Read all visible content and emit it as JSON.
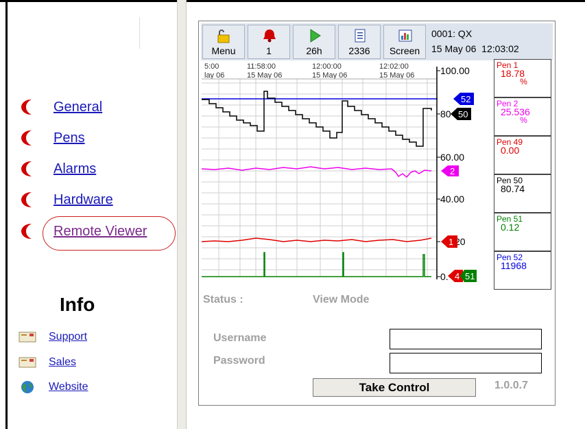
{
  "nav": {
    "items": [
      {
        "label": "General"
      },
      {
        "label": "Pens"
      },
      {
        "label": "Alarms"
      },
      {
        "label": "Hardware"
      },
      {
        "label": "Remote Viewer"
      }
    ]
  },
  "info": {
    "title": "Info",
    "links": [
      {
        "label": "Support",
        "icon": "envelope-icon"
      },
      {
        "label": "Sales",
        "icon": "envelope-icon"
      },
      {
        "label": "Website",
        "icon": "globe-icon"
      }
    ]
  },
  "toolbar": {
    "buttons": [
      {
        "label": "Menu",
        "icon": "padlock-icon"
      },
      {
        "label": "1",
        "icon": "alarm-bell-icon"
      },
      {
        "label": "26h",
        "icon": "play-icon"
      },
      {
        "label": "2336",
        "icon": "list-icon"
      },
      {
        "label": "Screen",
        "icon": "screen-chart-icon"
      }
    ],
    "device": "0001: QX",
    "date": "15 May 06",
    "time": "12:03:02"
  },
  "chart": {
    "time_ticks": [
      {
        "time": "5:00",
        "date": "lay 06"
      },
      {
        "time": "11:58:00",
        "date": "15 May 06"
      },
      {
        "time": "12:00:00",
        "date": "15 May 06"
      },
      {
        "time": "12:02:00",
        "date": "15 May 06"
      }
    ],
    "scale_labels": [
      "100.00",
      "80",
      "60.00",
      "40.00",
      "20",
      "0."
    ],
    "markers": [
      "52",
      "50",
      "2",
      "1",
      "4",
      "51"
    ],
    "colors": {
      "pen1": "#e00000",
      "pen2": "#ee00ee",
      "pen49": "#e00000",
      "pen50": "#000000",
      "pen51": "#008000",
      "pen52": "#0000e0"
    }
  },
  "pens": [
    {
      "name": "Pen 1",
      "value": "18.78",
      "unit": "%",
      "color": "#e00000"
    },
    {
      "name": "Pen 2",
      "value": "25.536",
      "unit": "%",
      "color": "#ee00ee"
    },
    {
      "name": "Pen 49",
      "value": "0.00",
      "unit": "",
      "color": "#e00000"
    },
    {
      "name": "Pen 50",
      "value": "80.74",
      "unit": "",
      "color": "#000000"
    },
    {
      "name": "Pen 51",
      "value": "0.12",
      "unit": "",
      "color": "#008000"
    },
    {
      "name": "Pen 52",
      "value": "11968",
      "unit": "",
      "color": "#0000e0"
    }
  ],
  "status": {
    "label": "Status :",
    "mode": "View Mode"
  },
  "login": {
    "username_label": "Username",
    "password_label": "Password",
    "username_value": "",
    "password_value": "",
    "button_label": "Take Control",
    "version": "1.0.0.7"
  }
}
